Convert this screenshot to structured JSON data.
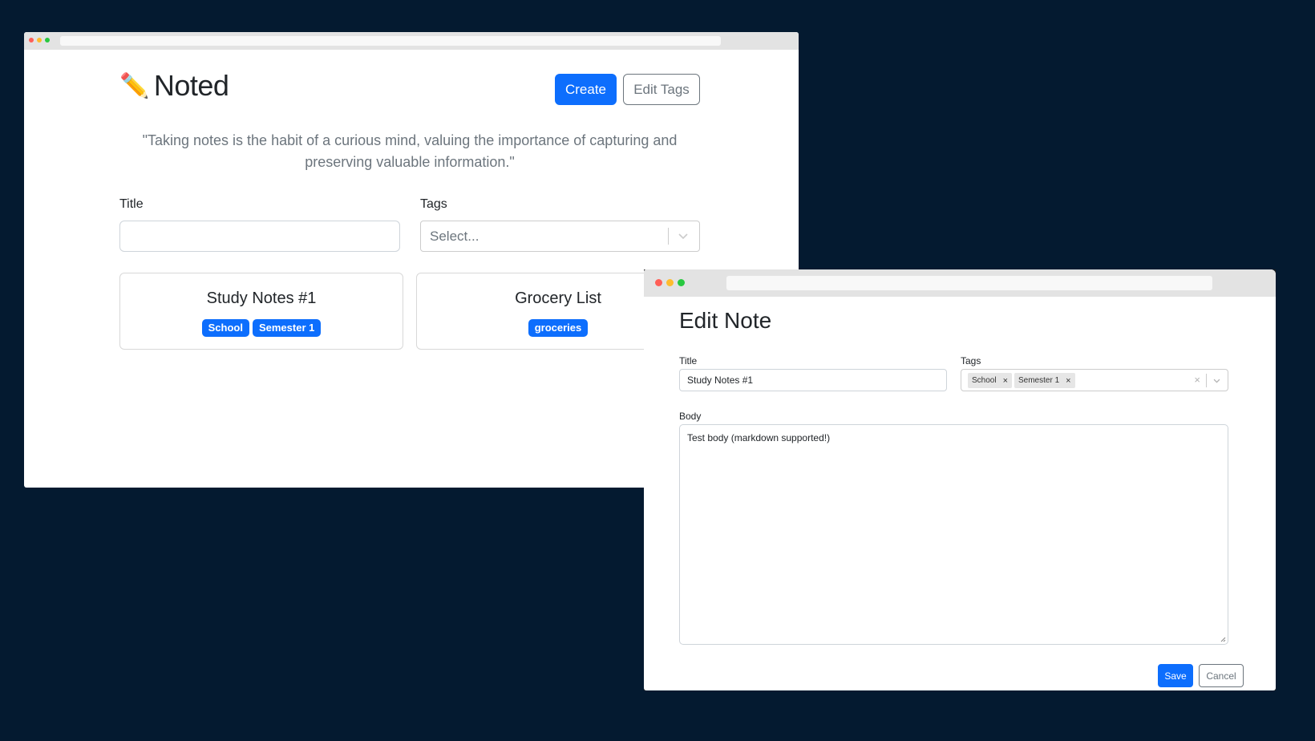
{
  "main_window": {
    "app": {
      "icon": "pencil-icon",
      "icon_glyph": "✏️",
      "title": "Noted"
    },
    "header": {
      "create_label": "Create",
      "edit_tags_label": "Edit Tags"
    },
    "quote": "\"Taking notes is the habit of a curious mind, valuing the importance of capturing and preserving valuable information.\"",
    "filters": {
      "title_label": "Title",
      "title_value": "",
      "tags_label": "Tags",
      "tags_placeholder": "Select..."
    },
    "notes": [
      {
        "title": "Study Notes #1",
        "tags": [
          "School",
          "Semester 1"
        ]
      },
      {
        "title": "Grocery List",
        "tags": [
          "groceries"
        ]
      }
    ]
  },
  "edit_window": {
    "heading": "Edit Note",
    "title_label": "Title",
    "title_value": "Study Notes #1",
    "tags_label": "Tags",
    "tags": [
      "School",
      "Semester 1"
    ],
    "tag_remove_glyph": "×",
    "clear_glyph": "×",
    "body_label": "Body",
    "body_value": "Test body (markdown supported!)",
    "save_label": "Save",
    "cancel_label": "Cancel"
  },
  "colors": {
    "background": "#041a30",
    "primary": "#0d6efd",
    "secondary": "#6c757d",
    "titlebar": "#e3e3e3",
    "traffic_red": "#ff5f57",
    "traffic_yellow": "#febc2e",
    "traffic_green": "#28c840"
  }
}
